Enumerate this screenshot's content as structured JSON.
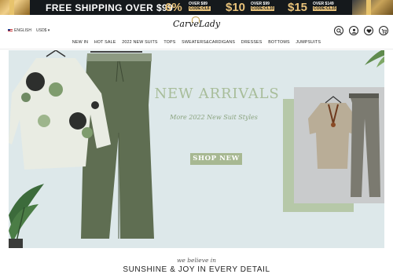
{
  "promo": {
    "free_shipping": "FREE SHIPPING OVER $99",
    "deals": [
      {
        "amount": "6%",
        "over": "OVER $89",
        "code": "CODE:CL6"
      },
      {
        "amount": "$10",
        "over": "OVER $99",
        "code": "CODE:CL10"
      },
      {
        "amount": "$15",
        "over": "OVER $149",
        "code": "CODE:CL15"
      }
    ]
  },
  "header": {
    "language": "ENGLISH",
    "currency": "USD$",
    "logo": {
      "first": "Carve",
      "second": "Lady"
    },
    "icons": [
      "search-icon",
      "account-icon",
      "wishlist-icon",
      "cart-icon"
    ],
    "wishlist_count": "0",
    "cart_count": "0"
  },
  "nav": {
    "items": [
      "NEW IN",
      "HOT SALE",
      "2022 NEW SUITS",
      "TOPS",
      "SWEATERS&CARDIGANS",
      "DRESSES",
      "BOTTOMS",
      "JUMPSUITS"
    ]
  },
  "hero": {
    "title": "NEW ARRIVALS",
    "subtitle": "More 2022 New Suit Styles",
    "button": "SHOP NEW"
  },
  "tagline": {
    "small": "we believe in",
    "large": "SUNSHINE & JOY IN EVERY DETAIL"
  },
  "colors": {
    "promo_bg": "#15191c",
    "gold": "#e8c27a",
    "hero_bg": "#dde8ea",
    "sage": "#a7b892",
    "olive": "#5f6e52"
  }
}
